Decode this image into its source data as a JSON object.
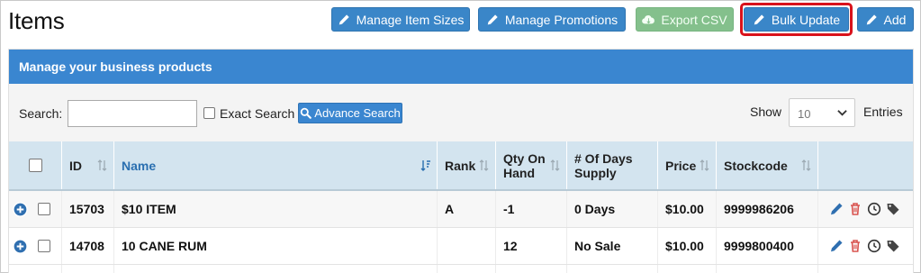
{
  "page": {
    "title": "Items"
  },
  "toolbar": {
    "manage_item_sizes": "Manage Item Sizes",
    "manage_promotions": "Manage Promotions",
    "export_csv": "Export CSV",
    "bulk_update": "Bulk Update",
    "add": "Add"
  },
  "panel": {
    "heading": "Manage your business products"
  },
  "search": {
    "label": "Search:",
    "value": "",
    "exact_label": "Exact Search",
    "exact_checked": false,
    "advance_label": "Advance Search"
  },
  "show": {
    "label": "Show",
    "selected": "10",
    "entries_label": "Entries"
  },
  "table": {
    "columns": {
      "id": "ID",
      "name": "Name",
      "rank": "Rank",
      "qty_line1": "Qty On",
      "qty_line2": "Hand",
      "days_line1": "# Of Days",
      "days_line2": "Supply",
      "price": "Price",
      "stockcode": "Stockcode"
    },
    "rows": [
      {
        "id": "15703",
        "name": "$10 ITEM",
        "rank": "A",
        "qty": "-1",
        "days": "0 Days",
        "price": "$10.00",
        "stockcode": "9999986206"
      },
      {
        "id": "14708",
        "name": "10 CANE RUM",
        "rank": "",
        "qty": "12",
        "days": "No Sale",
        "price": "$10.00",
        "stockcode": "9999800400"
      }
    ]
  },
  "colors": {
    "primary": "#3a86d0",
    "success": "#84c08c",
    "highlight": "#d9121b",
    "edit_icon": "#2f6fb0",
    "delete_icon": "#d9534f",
    "header_bg": "#d3e4ef"
  },
  "icons": [
    "pencil-icon",
    "cloud-download-icon",
    "search-icon",
    "sort-icon",
    "sort-down-icon",
    "plus-circle-icon",
    "trash-icon",
    "clock-icon",
    "tag-icon",
    "chevron-down-icon"
  ]
}
